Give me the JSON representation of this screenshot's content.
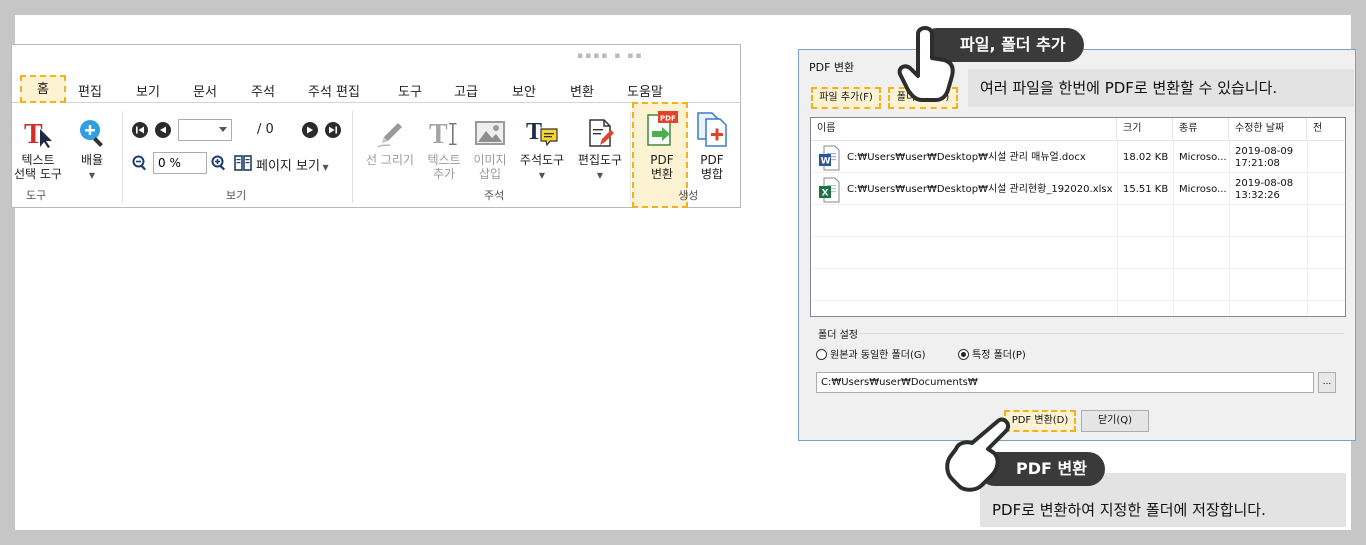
{
  "ribbon": {
    "tabs": [
      "홈",
      "편집",
      "보기",
      "문서",
      "주석",
      "주석 편집",
      "도구",
      "고급",
      "보안",
      "변환",
      "도움말"
    ],
    "text_select_label": "텍스트\n선택 도구",
    "zoom_label": "배율",
    "page_total": "/ 0",
    "zoom_value": "0 %",
    "page_view_label": "페이지 보기",
    "draw_line_label": "선 그리기",
    "add_text_label": "텍스트\n추가",
    "insert_image_label": "이미지\n삽입",
    "annot_tool_label": "주석도구",
    "edit_tool_label": "편집도구",
    "pdf_convert_label": "PDF\n변환",
    "pdf_merge_label": "PDF\n병합",
    "groups": {
      "tools": "도구",
      "view": "보기",
      "annotation": "주석",
      "create": "생성"
    }
  },
  "dialog": {
    "title": "PDF 변환",
    "add_file": "파일 추가(F)",
    "add_folder": "폴더추가(O)",
    "columns": [
      "이름",
      "크기",
      "종류",
      "수정한 날짜",
      "전"
    ],
    "files": [
      {
        "icon": "word-icon",
        "path": "C:₩Users₩user₩Desktop₩시설 관리 매뉴얼.docx",
        "size": "18.02 KB",
        "type": "Microso...",
        "date": "2019-08-09",
        "time": "17:21:08"
      },
      {
        "icon": "excel-icon",
        "path": "C:₩Users₩user₩Desktop₩시설 관리현황_192020.xlsx",
        "size": "15.51 KB",
        "type": "Microso...",
        "date": "2019-08-08",
        "time": "13:32:26"
      }
    ],
    "folder_settings": "폴더 설정",
    "radio_same": "원본과 동일한 폴더(G)",
    "radio_specific": "특정 폴더(P)",
    "output_path": "C:₩Users₩user₩Documents₩",
    "browse": "...",
    "convert_btn": "PDF 변환(D)",
    "close_btn": "닫기(Q)"
  },
  "callouts": {
    "top_title": "파일, 폴더 추가",
    "top_desc": "여러 파일을 한번에 PDF로 변환할 수 있습니다.",
    "bottom_title": "PDF 변환",
    "bottom_desc": "PDF로 변환하여 지정한 폴더에 저장합니다."
  },
  "colors": {
    "highlight": "#f2b220",
    "highlight_fill": "#fdf3d2",
    "pill": "#3a3a3a",
    "dialog_border": "#7aa0cc"
  }
}
